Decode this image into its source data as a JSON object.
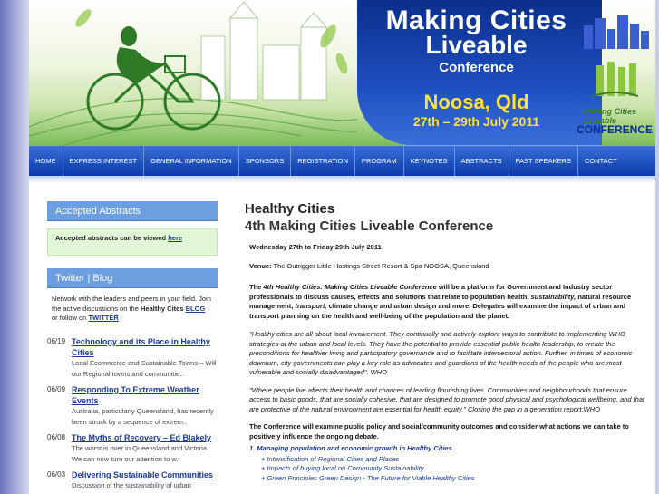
{
  "banner": {
    "title_line1": "Making Cities",
    "title_line2": "Liveable",
    "title_line3": "Conference",
    "location": "Noosa, Qld",
    "dates": "27th – 29th July 2011",
    "logo_line1": "Making Cities Liveable",
    "logo_line2": "CONFERENCE"
  },
  "nav": {
    "items": [
      "HOME",
      "EXPRESS INTEREST",
      "GENERAL INFORMATION",
      "SPONSORS",
      "REGISTRATION",
      "PROGRAM",
      "KEYNOTES",
      "ABSTRACTS",
      "PAST SPEAKERS",
      "CONTACT"
    ]
  },
  "sidebar": {
    "abstracts_header": "Accepted Abstracts",
    "abstracts_text": "Accepted abstracts can be viewed",
    "abstracts_link": "here",
    "twitter_header": "Twitter | Blog",
    "twitter_desc": "Network with the leaders and peers in your field. Join the active discussions on the",
    "twitter_desc_bold": "Healthy Cites",
    "blog_link": "BLOG",
    "follow_text": "or follow on",
    "twitter_link": "TWITTER",
    "posts": [
      {
        "date": "06/19",
        "title": "Technology and its Place in Healthy Cities",
        "excerpt": "Local Ecommerce and Sustainable Towns – Will our Regional towns and communitie.."
      },
      {
        "date": "06/09",
        "title": "Responding To Extreme Weather Events",
        "excerpt": "Australia, particularly Queensland, has recently been struck by a sequence of extrem.."
      },
      {
        "date": "06/08",
        "title": "The Myths of Recovery – Ed Blakely",
        "excerpt": "The worst is over in Queensland and Victoria. We can now turn our attention to w.."
      },
      {
        "date": "06/03",
        "title": "Delivering Sustainable Communities",
        "excerpt": "Discussion of the sustainability of urban"
      }
    ]
  },
  "main": {
    "title": "Healthy Cities",
    "subtitle": "4th Making Cities Liveable Conference",
    "dates": "Wednesday 27th to Friday 29th July  2011",
    "venue_label": "Venue:",
    "venue": "The Outrigger Little Hastings Street Resort & Spa NOOSA, Queensland",
    "intro_prefix": "The",
    "intro_em": "4th Healthy Cities: Making Cities Liveable Conference",
    "intro_mid": "will be a platform for Government and Industry sector professionals to discuss causes, effects and solutions that relate to population health,",
    "intro_em2": "sustainability,",
    "intro_mid2": "natural resource management,",
    "intro_em3": "transport,",
    "intro_end": "climate change and urban design and more. Delegates will examine the impact of urban and transport planning on the health and well-being of the population and the planet.",
    "quote1": "\"Healthy cities are all about local involvement. They continually and actively explore ways to contribute to implementing WHO strategies at the urban and local levels. They have the potential to provide essential public health leadership, to create the preconditions for healthier living and participatory governance and to facilitate intersectoral action. Further, in times of economic downturn, city governments can play a key role as advocates and guardians of the health needs of the people who are most vulnerable and socially disadvantaged\". WHO",
    "quote2": "\"Where people live affects their health and chances of leading flourishing lives. Communities and neighbourhoods that ensure access to basic goods, that are socially cohesive, that are designed to promote good physical and psychological wellbeing, and that are protective of the natural environment are essential for health equity.\" Closing the gap in a generation report;WHO",
    "conference_text": "The Conference will examine public policy and social/community outcomes and consider what actions we can take to positively influence the ongoing debate.",
    "section1": "1. Managing population and economic growth in Healthy Cities",
    "bullets": [
      "+ Intensification of Regional Cities and Places",
      "+ Impacts of buying local on Community Sustainability",
      "+ Green Principles Green Design - The Future for Viable Healthy Cities"
    ]
  },
  "colors": {
    "nav_blue": "#0a3aa8",
    "side_header": "#6b9fe0",
    "link_blue": "#1a3a9a",
    "banner_yellow": "#ffe13a",
    "green_box": "#e1f6d6"
  }
}
